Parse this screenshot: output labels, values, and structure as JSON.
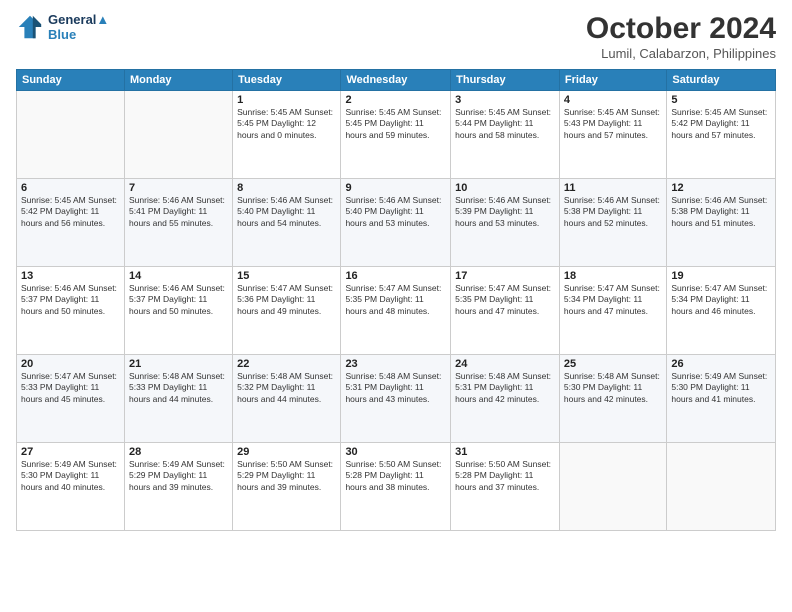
{
  "header": {
    "logo_line1": "General",
    "logo_line2": "Blue",
    "title": "October 2024",
    "location": "Lumil, Calabarzon, Philippines"
  },
  "weekdays": [
    "Sunday",
    "Monday",
    "Tuesday",
    "Wednesday",
    "Thursday",
    "Friday",
    "Saturday"
  ],
  "weeks": [
    [
      {
        "day": "",
        "info": ""
      },
      {
        "day": "",
        "info": ""
      },
      {
        "day": "1",
        "info": "Sunrise: 5:45 AM\nSunset: 5:45 PM\nDaylight: 12 hours\nand 0 minutes."
      },
      {
        "day": "2",
        "info": "Sunrise: 5:45 AM\nSunset: 5:45 PM\nDaylight: 11 hours\nand 59 minutes."
      },
      {
        "day": "3",
        "info": "Sunrise: 5:45 AM\nSunset: 5:44 PM\nDaylight: 11 hours\nand 58 minutes."
      },
      {
        "day": "4",
        "info": "Sunrise: 5:45 AM\nSunset: 5:43 PM\nDaylight: 11 hours\nand 57 minutes."
      },
      {
        "day": "5",
        "info": "Sunrise: 5:45 AM\nSunset: 5:42 PM\nDaylight: 11 hours\nand 57 minutes."
      }
    ],
    [
      {
        "day": "6",
        "info": "Sunrise: 5:45 AM\nSunset: 5:42 PM\nDaylight: 11 hours\nand 56 minutes."
      },
      {
        "day": "7",
        "info": "Sunrise: 5:46 AM\nSunset: 5:41 PM\nDaylight: 11 hours\nand 55 minutes."
      },
      {
        "day": "8",
        "info": "Sunrise: 5:46 AM\nSunset: 5:40 PM\nDaylight: 11 hours\nand 54 minutes."
      },
      {
        "day": "9",
        "info": "Sunrise: 5:46 AM\nSunset: 5:40 PM\nDaylight: 11 hours\nand 53 minutes."
      },
      {
        "day": "10",
        "info": "Sunrise: 5:46 AM\nSunset: 5:39 PM\nDaylight: 11 hours\nand 53 minutes."
      },
      {
        "day": "11",
        "info": "Sunrise: 5:46 AM\nSunset: 5:38 PM\nDaylight: 11 hours\nand 52 minutes."
      },
      {
        "day": "12",
        "info": "Sunrise: 5:46 AM\nSunset: 5:38 PM\nDaylight: 11 hours\nand 51 minutes."
      }
    ],
    [
      {
        "day": "13",
        "info": "Sunrise: 5:46 AM\nSunset: 5:37 PM\nDaylight: 11 hours\nand 50 minutes."
      },
      {
        "day": "14",
        "info": "Sunrise: 5:46 AM\nSunset: 5:37 PM\nDaylight: 11 hours\nand 50 minutes."
      },
      {
        "day": "15",
        "info": "Sunrise: 5:47 AM\nSunset: 5:36 PM\nDaylight: 11 hours\nand 49 minutes."
      },
      {
        "day": "16",
        "info": "Sunrise: 5:47 AM\nSunset: 5:35 PM\nDaylight: 11 hours\nand 48 minutes."
      },
      {
        "day": "17",
        "info": "Sunrise: 5:47 AM\nSunset: 5:35 PM\nDaylight: 11 hours\nand 47 minutes."
      },
      {
        "day": "18",
        "info": "Sunrise: 5:47 AM\nSunset: 5:34 PM\nDaylight: 11 hours\nand 47 minutes."
      },
      {
        "day": "19",
        "info": "Sunrise: 5:47 AM\nSunset: 5:34 PM\nDaylight: 11 hours\nand 46 minutes."
      }
    ],
    [
      {
        "day": "20",
        "info": "Sunrise: 5:47 AM\nSunset: 5:33 PM\nDaylight: 11 hours\nand 45 minutes."
      },
      {
        "day": "21",
        "info": "Sunrise: 5:48 AM\nSunset: 5:33 PM\nDaylight: 11 hours\nand 44 minutes."
      },
      {
        "day": "22",
        "info": "Sunrise: 5:48 AM\nSunset: 5:32 PM\nDaylight: 11 hours\nand 44 minutes."
      },
      {
        "day": "23",
        "info": "Sunrise: 5:48 AM\nSunset: 5:31 PM\nDaylight: 11 hours\nand 43 minutes."
      },
      {
        "day": "24",
        "info": "Sunrise: 5:48 AM\nSunset: 5:31 PM\nDaylight: 11 hours\nand 42 minutes."
      },
      {
        "day": "25",
        "info": "Sunrise: 5:48 AM\nSunset: 5:30 PM\nDaylight: 11 hours\nand 42 minutes."
      },
      {
        "day": "26",
        "info": "Sunrise: 5:49 AM\nSunset: 5:30 PM\nDaylight: 11 hours\nand 41 minutes."
      }
    ],
    [
      {
        "day": "27",
        "info": "Sunrise: 5:49 AM\nSunset: 5:30 PM\nDaylight: 11 hours\nand 40 minutes."
      },
      {
        "day": "28",
        "info": "Sunrise: 5:49 AM\nSunset: 5:29 PM\nDaylight: 11 hours\nand 39 minutes."
      },
      {
        "day": "29",
        "info": "Sunrise: 5:50 AM\nSunset: 5:29 PM\nDaylight: 11 hours\nand 39 minutes."
      },
      {
        "day": "30",
        "info": "Sunrise: 5:50 AM\nSunset: 5:28 PM\nDaylight: 11 hours\nand 38 minutes."
      },
      {
        "day": "31",
        "info": "Sunrise: 5:50 AM\nSunset: 5:28 PM\nDaylight: 11 hours\nand 37 minutes."
      },
      {
        "day": "",
        "info": ""
      },
      {
        "day": "",
        "info": ""
      }
    ]
  ]
}
